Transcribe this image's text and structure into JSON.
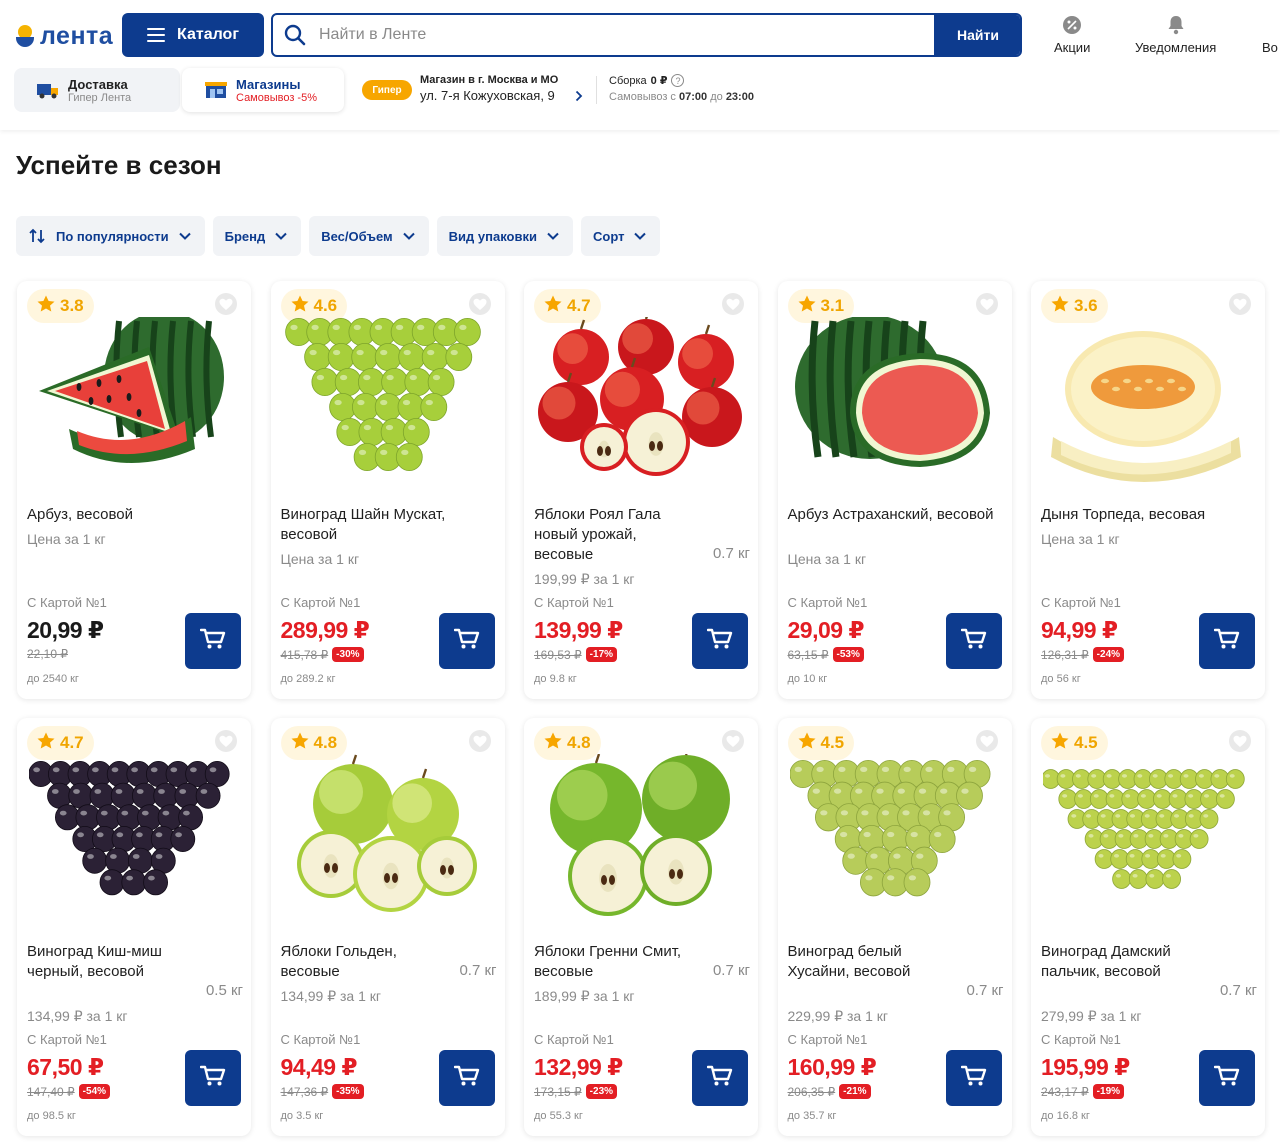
{
  "header": {
    "logo_text": "лента",
    "catalog_label": "Каталог",
    "search_placeholder": "Найти в Ленте",
    "search_button": "Найти",
    "actions": [
      "Акции",
      "Уведомления",
      "Во"
    ],
    "delivery": {
      "title": "Доставка",
      "sub": "Гипер Лента"
    },
    "stores": {
      "title": "Магазины",
      "sub": "Самовывоз -5%"
    },
    "store_badge": "Гипер",
    "store_line1": "Магазин в г. Москва и МО",
    "store_line2": "ул. 7-я Кожуховская, 9",
    "assembly_prefix": "Сборка",
    "assembly_value": "0 ₽",
    "pickup_text": "Самовывоз с",
    "pickup_from": "07:00",
    "pickup_mid": "до",
    "pickup_to": "23:00"
  },
  "page_title": "Успейте в сезон",
  "filters": [
    "По популярности",
    "Бренд",
    "Вес/Объем",
    "Вид упаковки",
    "Сорт"
  ],
  "card_label": "С Картой №1",
  "colors": {
    "brand": "#0d3b8e",
    "sale": "#e31e24",
    "rating": "#f0a500"
  },
  "products": [
    {
      "rating": "3.8",
      "name": "Арбуз, весовой",
      "weight": "",
      "unit": "Цена за 1 кг",
      "price": "20,99 ₽",
      "sale": false,
      "old": "22,10 ₽",
      "discount": "",
      "max": "до 2540 кг",
      "img": "watermelon"
    },
    {
      "rating": "4.6",
      "name": "Виноград Шайн Мускат, весовой",
      "weight": "",
      "unit": "Цена за 1 кг",
      "price": "289,99 ₽",
      "sale": true,
      "old": "415,78 ₽",
      "discount": "-30%",
      "max": "до 289.2 кг",
      "img": "grapes-green"
    },
    {
      "rating": "4.7",
      "name": "Яблоки Роял Гала новый урожай, весовые",
      "weight": "0.7 кг",
      "unit": "199,99 ₽ за 1 кг",
      "price": "139,99 ₽",
      "sale": true,
      "old": "169,53 ₽",
      "discount": "-17%",
      "max": "до 9.8 кг",
      "img": "apples-red"
    },
    {
      "rating": "3.1",
      "name": "Арбуз Астраханский, весовой",
      "weight": "",
      "unit": "Цена за 1 кг",
      "price": "29,09 ₽",
      "sale": true,
      "old": "63,15 ₽",
      "discount": "-53%",
      "max": "до 10 кг",
      "img": "watermelon2"
    },
    {
      "rating": "3.6",
      "name": "Дыня Торпеда, весовая",
      "weight": "",
      "unit": "Цена за 1 кг",
      "price": "94,99 ₽",
      "sale": true,
      "old": "126,31 ₽",
      "discount": "-24%",
      "max": "до 56 кг",
      "img": "melon"
    },
    {
      "rating": "4.7",
      "name": "Виноград Киш-миш черный, весовой",
      "weight": "0.5 кг",
      "unit": "134,99 ₽ за 1 кг",
      "price": "67,50 ₽",
      "sale": true,
      "old": "147,40 ₽",
      "discount": "-54%",
      "max": "до 98.5 кг",
      "img": "grapes-black"
    },
    {
      "rating": "4.8",
      "name": "Яблоки Гольден, весовые",
      "weight": "0.7 кг",
      "unit": "134,99 ₽ за 1 кг",
      "price": "94,49 ₽",
      "sale": true,
      "old": "147,36 ₽",
      "discount": "-35%",
      "max": "до 3.5 кг",
      "img": "apples-yellow"
    },
    {
      "rating": "4.8",
      "name": "Яблоки Гренни Смит, весовые",
      "weight": "0.7 кг",
      "unit": "189,99 ₽ за 1 кг",
      "price": "132,99 ₽",
      "sale": true,
      "old": "173,15 ₽",
      "discount": "-23%",
      "max": "до 55.3 кг",
      "img": "apples-green"
    },
    {
      "rating": "4.5",
      "name": "Виноград белый Хусайни, весовой",
      "weight": "0.7 кг",
      "unit": "229,99 ₽ за 1 кг",
      "price": "160,99 ₽",
      "sale": true,
      "old": "206,35 ₽",
      "discount": "-21%",
      "max": "до 35.7 кг",
      "img": "grapes-white"
    },
    {
      "rating": "4.5",
      "name": "Виноград Дамский пальчик, весовой",
      "weight": "0.7 кг",
      "unit": "279,99 ₽ за 1 кг",
      "price": "195,99 ₽",
      "sale": true,
      "old": "243,17 ₽",
      "discount": "-19%",
      "max": "до 16.8 кг",
      "img": "grapes-finger"
    }
  ]
}
